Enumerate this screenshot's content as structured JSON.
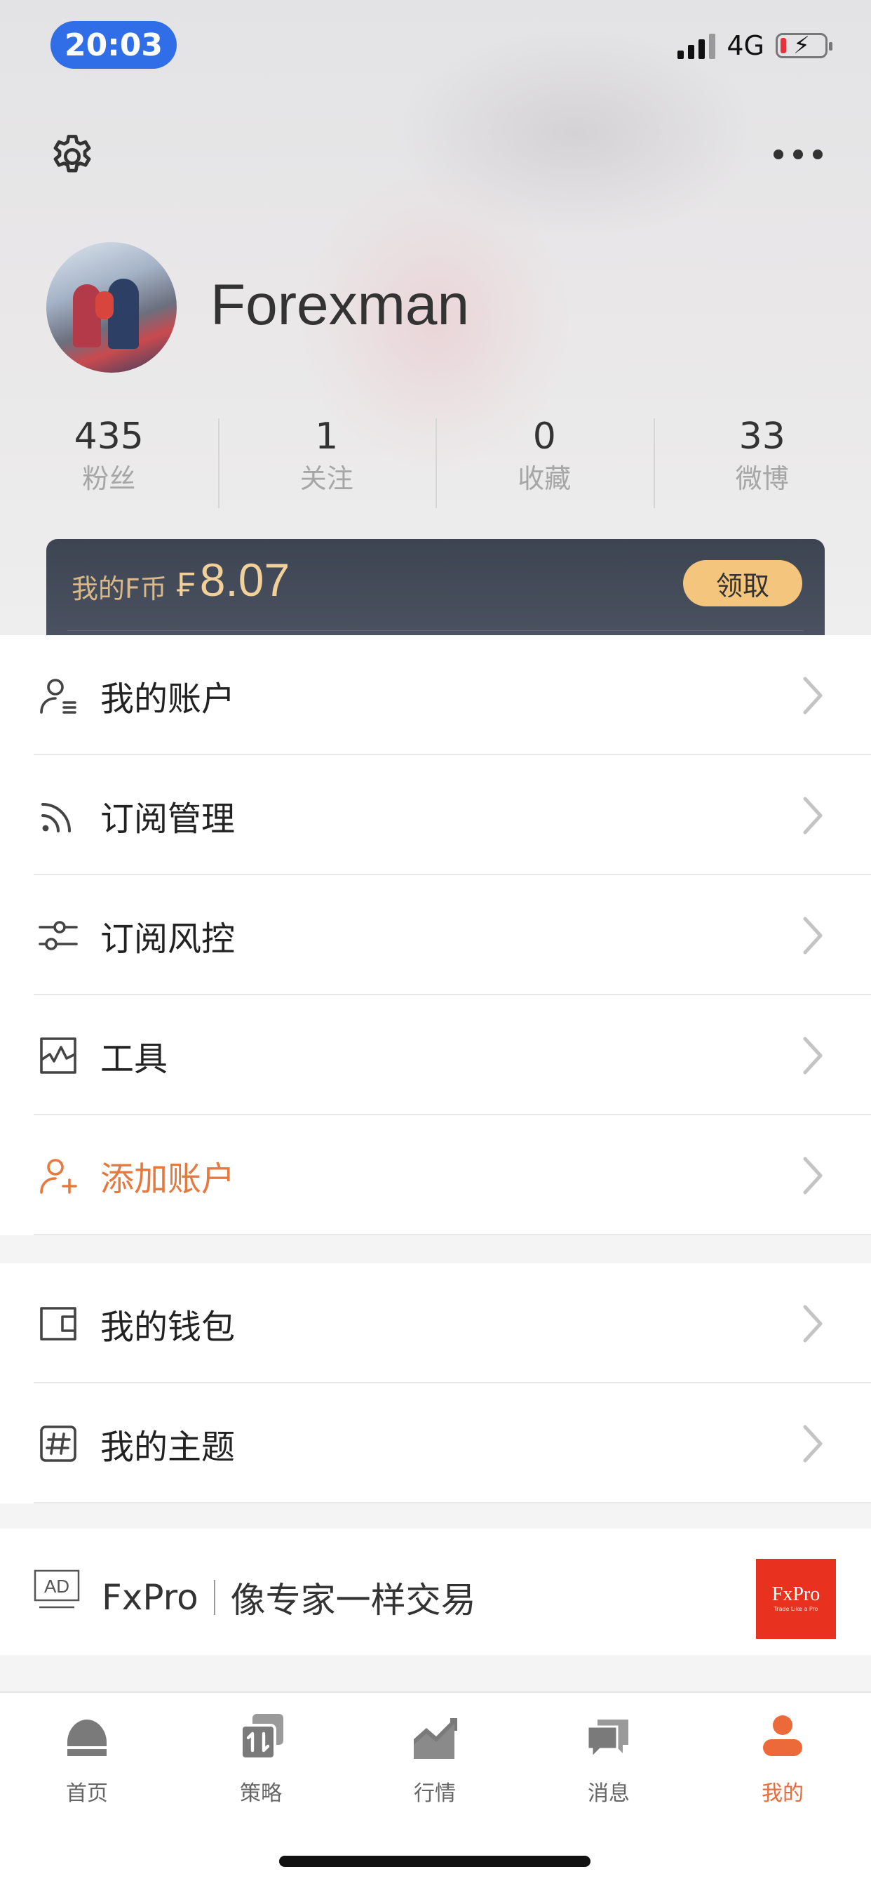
{
  "status_bar": {
    "time": "20:03",
    "network": "4G"
  },
  "header": {
    "settings_icon": "gear-icon",
    "more_icon": "more-dots-icon"
  },
  "profile": {
    "username": "Forexman"
  },
  "stats": [
    {
      "value": "435",
      "label": "粉丝"
    },
    {
      "value": "1",
      "label": "关注"
    },
    {
      "value": "0",
      "label": "收藏"
    },
    {
      "value": "33",
      "label": "微博"
    }
  ],
  "coins": {
    "label": "我的F币",
    "symbol": "₣",
    "value": "8.07",
    "claim_label": "领取"
  },
  "menu_group_1": [
    {
      "label": "我的账户",
      "icon": "account-icon"
    },
    {
      "label": "订阅管理",
      "icon": "rss-icon"
    },
    {
      "label": "订阅风控",
      "icon": "sliders-icon"
    },
    {
      "label": "工具",
      "icon": "chart-tool-icon"
    },
    {
      "label": "添加账户",
      "icon": "add-user-icon",
      "accent": "#e8793e"
    }
  ],
  "menu_group_2": [
    {
      "label": "我的钱包",
      "icon": "wallet-icon"
    },
    {
      "label": "我的主题",
      "icon": "hashtag-icon"
    }
  ],
  "ad": {
    "badge": "AD",
    "brand": "FxPro",
    "slogan": "像专家一样交易",
    "logo_text": "FxPro",
    "logo_subtext": "Trade Like a Pro",
    "logo_color": "#e8321f"
  },
  "tabbar": [
    {
      "label": "首页",
      "icon": "home-icon"
    },
    {
      "label": "策略",
      "icon": "strategy-icon"
    },
    {
      "label": "行情",
      "icon": "market-icon"
    },
    {
      "label": "消息",
      "icon": "message-icon"
    },
    {
      "label": "我的",
      "icon": "profile-icon",
      "active": true
    }
  ],
  "colors": {
    "accent": "#ec6a3a",
    "time_pill": "#2f6ee6",
    "coin_card": "#3d4452",
    "claim_button": "#f4c57d"
  }
}
